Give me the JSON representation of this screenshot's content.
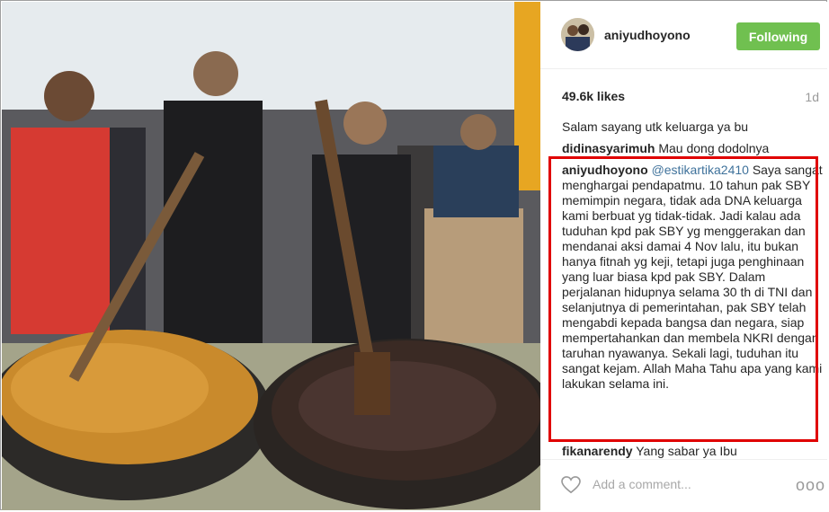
{
  "post": {
    "username": "aniyudhoyono",
    "follow_label": "Following",
    "likes": "49.6k likes",
    "age": "1d",
    "caption": "Salam sayang utk keluarga ya bu"
  },
  "comments": [
    {
      "user": "didinasyarimuh",
      "text": "Mau dong dodolnya"
    },
    {
      "user": "aniyudhoyono",
      "mention": "@estikartika2410",
      "text": "Saya sangat menghargai pendapatmu. 10 tahun pak SBY memimpin negara, tidak ada DNA keluarga kami berbuat yg tidak-tidak. Jadi kalau ada tuduhan kpd pak SBY yg menggerakan dan mendanai aksi damai 4 Nov lalu, itu bukan hanya fitnah yg keji, tetapi juga penghinaan yang luar biasa kpd pak SBY. Dalam perjalanan hidupnya selama 30 th di TNI dan selanjutnya di pemerintahan, pak SBY telah mengabdi kepada bangsa dan negara, siap mempertahankan dan membela NKRI dengan taruhan nyawanya. Sekali lagi, tuduhan itu sangat kejam. Allah Maha Tahu apa yang kami lakukan selama ini."
    },
    {
      "user": "fikanarendy",
      "text": "Yang sabar ya Ibu"
    }
  ],
  "footer": {
    "add_comment_placeholder": "Add a comment...",
    "more_label": "ooo"
  },
  "colors": {
    "follow_button": "#70c050",
    "mention": "#3f729b",
    "highlight_box": "#e00000"
  }
}
